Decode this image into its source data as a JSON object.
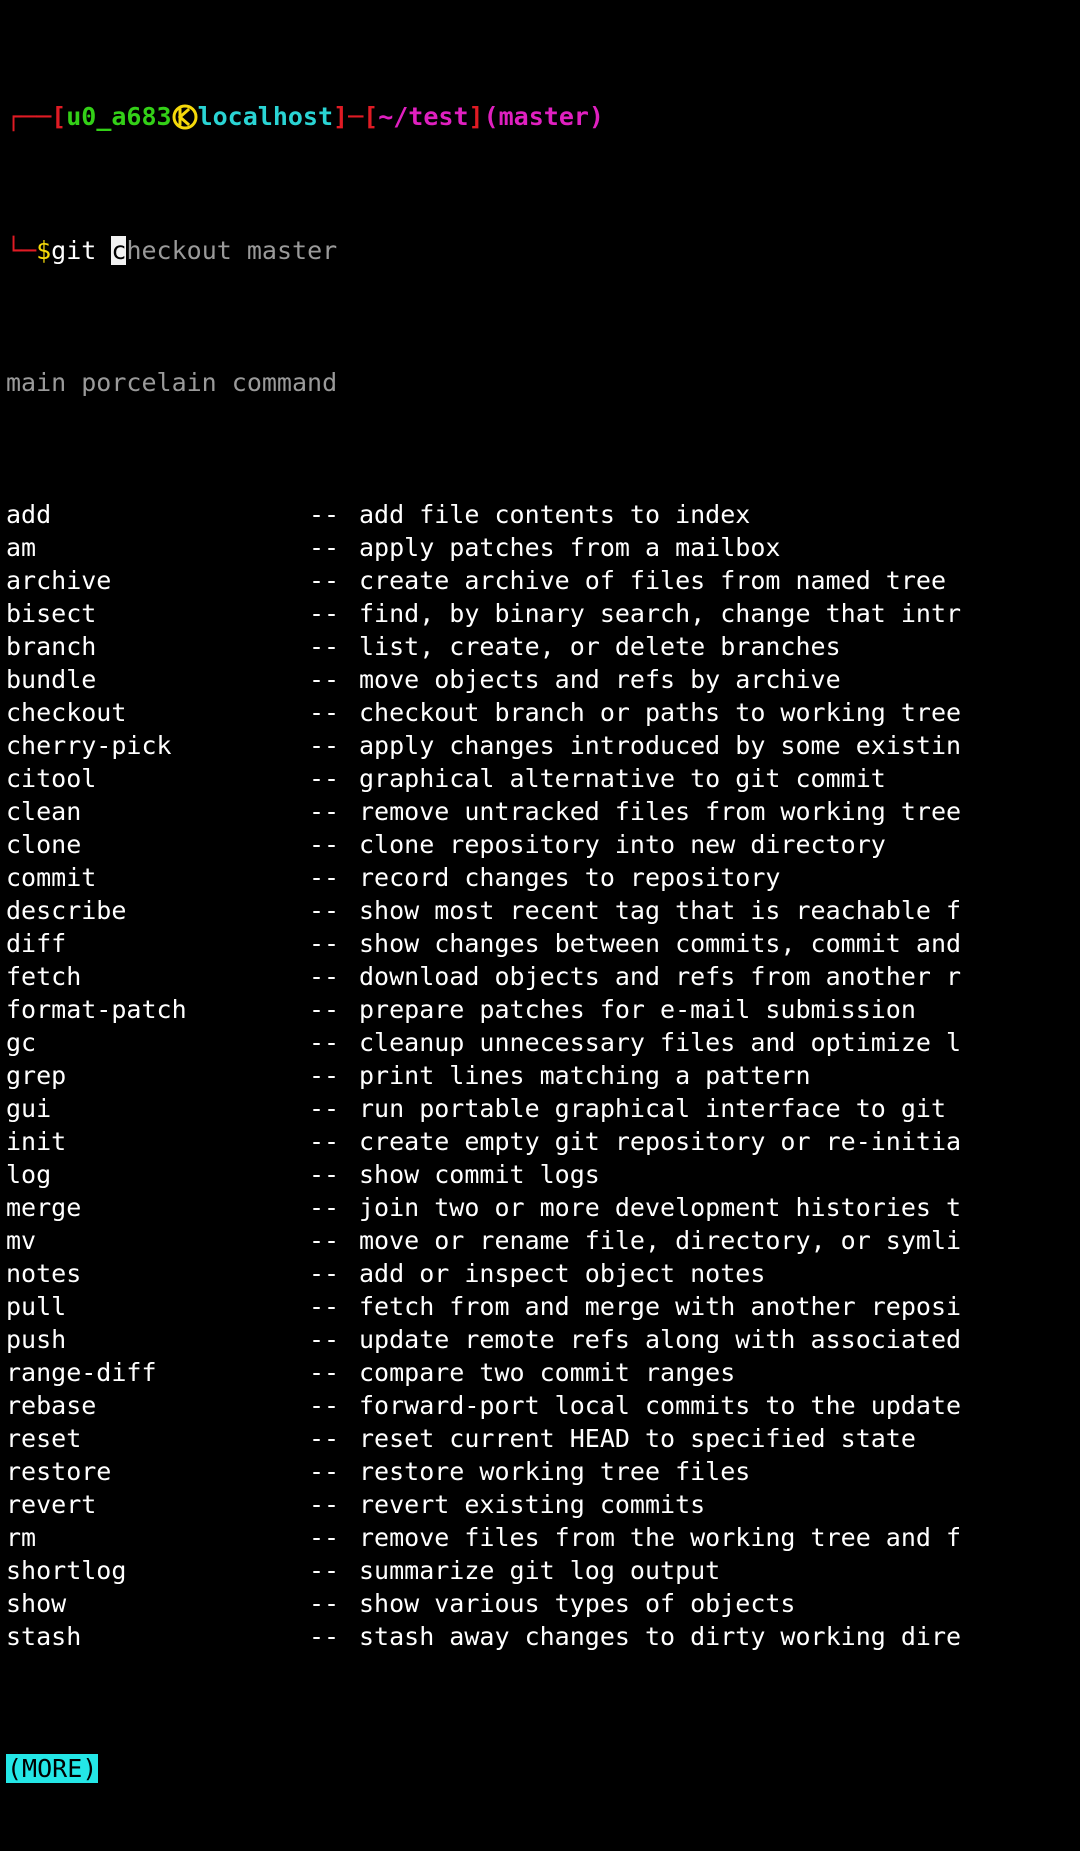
{
  "terminal": {
    "background_color": "#000000",
    "foreground_color": "#ffffff",
    "prompt": {
      "bracket_open": "┌──[",
      "user": "u0_a683",
      "host_icon": "kali-dragon-icon",
      "host": "localhost",
      "sep_close": "]─[",
      "path": "~/test",
      "path_close": "]",
      "branch": "(master)",
      "continuation": "└─",
      "symbol": "$",
      "colors": {
        "frame": "#e01b24",
        "user": "#33d017",
        "host": "#2ad4d4",
        "path": "#e020c0",
        "branch": "#e020c0",
        "symbol": "#f5d90a",
        "icon": "#f5d90a"
      }
    },
    "command_line": {
      "typed": "git ",
      "cursor_char": "c",
      "suggestion": "heckout master"
    },
    "completion_header": "main porcelain command",
    "more_indicator": "(MORE)",
    "separator": "--",
    "commands": [
      {
        "name": "add",
        "desc": "add file contents to index"
      },
      {
        "name": "am",
        "desc": "apply patches from a mailbox"
      },
      {
        "name": "archive",
        "desc": "create archive of files from named tree"
      },
      {
        "name": "bisect",
        "desc": "find, by binary search, change that intr"
      },
      {
        "name": "branch",
        "desc": "list, create, or delete branches"
      },
      {
        "name": "bundle",
        "desc": "move objects and refs by archive"
      },
      {
        "name": "checkout",
        "desc": "checkout branch or paths to working tree"
      },
      {
        "name": "cherry-pick",
        "desc": "apply changes introduced by some existin"
      },
      {
        "name": "citool",
        "desc": "graphical alternative to git commit"
      },
      {
        "name": "clean",
        "desc": "remove untracked files from working tree"
      },
      {
        "name": "clone",
        "desc": "clone repository into new directory"
      },
      {
        "name": "commit",
        "desc": "record changes to repository"
      },
      {
        "name": "describe",
        "desc": "show most recent tag that is reachable f"
      },
      {
        "name": "diff",
        "desc": "show changes between commits, commit and"
      },
      {
        "name": "fetch",
        "desc": "download objects and refs from another r"
      },
      {
        "name": "format-patch",
        "desc": "prepare patches for e-mail submission"
      },
      {
        "name": "gc",
        "desc": "cleanup unnecessary files and optimize l"
      },
      {
        "name": "grep",
        "desc": "print lines matching a pattern"
      },
      {
        "name": "gui",
        "desc": "run portable graphical interface to git"
      },
      {
        "name": "init",
        "desc": "create empty git repository or re-initia"
      },
      {
        "name": "log",
        "desc": "show commit logs"
      },
      {
        "name": "merge",
        "desc": "join two or more development histories t"
      },
      {
        "name": "mv",
        "desc": "move or rename file, directory, or symli"
      },
      {
        "name": "notes",
        "desc": "add or inspect object notes"
      },
      {
        "name": "pull",
        "desc": "fetch from and merge with another reposi"
      },
      {
        "name": "push",
        "desc": "update remote refs along with associated"
      },
      {
        "name": "range-diff",
        "desc": "compare two commit ranges"
      },
      {
        "name": "rebase",
        "desc": "forward-port local commits to the update"
      },
      {
        "name": "reset",
        "desc": "reset current HEAD to specified state"
      },
      {
        "name": "restore",
        "desc": "restore working tree files"
      },
      {
        "name": "revert",
        "desc": "revert existing commits"
      },
      {
        "name": "rm",
        "desc": "remove files from the working tree and f"
      },
      {
        "name": "shortlog",
        "desc": "summarize git log output"
      },
      {
        "name": "show",
        "desc": "show various types of objects"
      },
      {
        "name": "stash",
        "desc": "stash away changes to dirty working dire"
      }
    ]
  }
}
